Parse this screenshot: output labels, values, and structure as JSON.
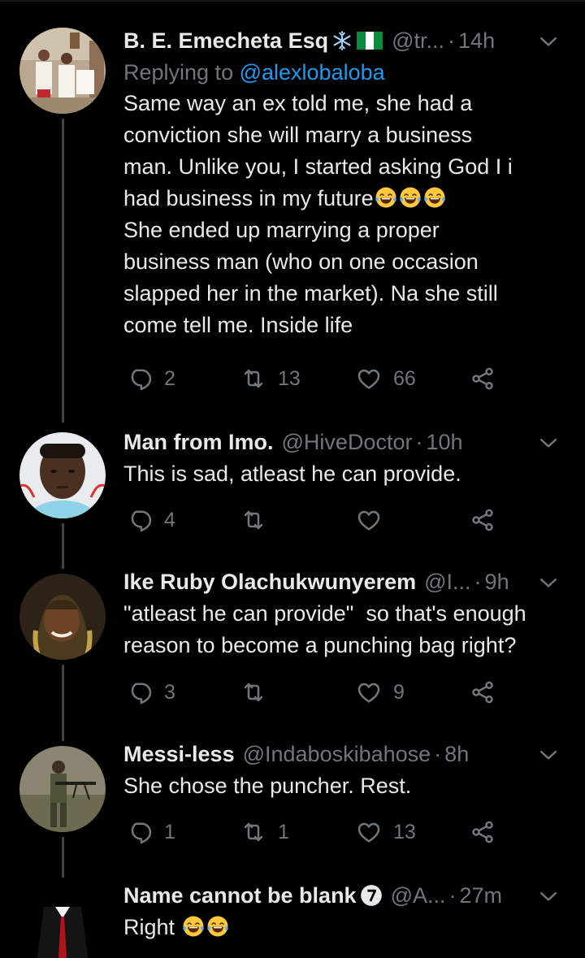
{
  "tweets": [
    {
      "name": "B. E. Emecheta Esq",
      "handle": "@tr...",
      "time": "14h",
      "replying_prefix": "Replying to ",
      "replying_to": "@alexlobaloba",
      "lines": [
        "Same way an ex told me, she had a",
        "conviction she will marry a business",
        "man. Unlike you, I started asking God I i",
        "had business in my future",
        "She ended up marrying a proper",
        "business man (who on one occasion",
        "slapped her in the market). Na she still",
        "come tell me. Inside life"
      ],
      "replies": "2",
      "retweets": "13",
      "likes": "66",
      "avatar_icon": "church-photo-avatar"
    },
    {
      "name": "Man from Imo.",
      "handle": "@HiveDoctor",
      "time": "10h",
      "lines": [
        "This is sad, atleast he can provide."
      ],
      "replies": "4",
      "retweets": "",
      "likes": "",
      "avatar_icon": "man-portrait-avatar"
    },
    {
      "name": "Ike Ruby Olachukwunyerem",
      "handle": "@I...",
      "time": "9h",
      "lines": [
        "\"atleast he can provide\"  so that's enough",
        "reason to become a punching bag right?"
      ],
      "replies": "3",
      "retweets": "",
      "likes": "9",
      "avatar_icon": "woman-portrait-avatar"
    },
    {
      "name": "Messi-less",
      "handle": "@Indaboskibahose",
      "time": "8h",
      "lines": [
        "She chose the puncher. Rest."
      ],
      "replies": "1",
      "retweets": "1",
      "likes": "13",
      "avatar_icon": "soldier-photo-avatar"
    },
    {
      "name": "Name cannot be blank",
      "handle": "@A...",
      "time": "27m",
      "lines": [
        "Right"
      ],
      "avatar_icon": "suit-figure-avatar"
    }
  ],
  "colors": {
    "background": "#000000",
    "text": "#e7e9ea",
    "secondary": "#71767b",
    "link": "#1d9bf0",
    "thread_line": "#3e4144"
  },
  "icons": [
    "reply-icon",
    "retweet-icon",
    "like-icon",
    "share-icon",
    "chevron-down-icon",
    "snowflake-icon",
    "nigeria-flag-icon",
    "number-7-badge-icon",
    "tears-of-joy-emoji"
  ]
}
